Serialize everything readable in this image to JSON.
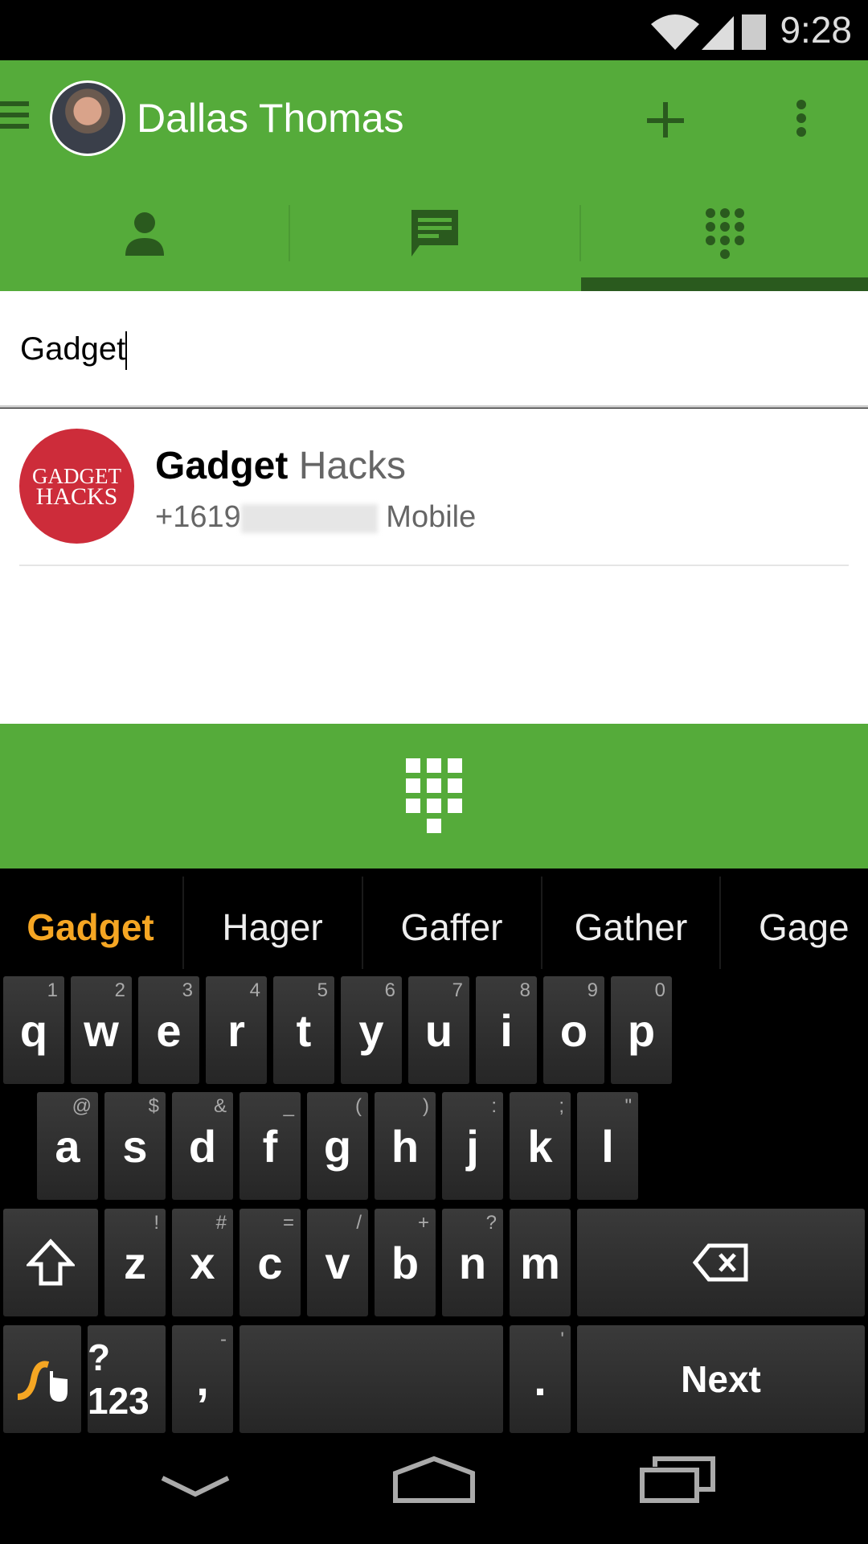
{
  "status": {
    "time": "9:28",
    "icons": [
      "wifi-icon",
      "signal-icon",
      "battery-icon"
    ]
  },
  "toolbar": {
    "title": "Dallas Thomas",
    "icons": [
      "menu-icon",
      "avatar",
      "add-icon",
      "more-icon"
    ],
    "color": "#55ab3a"
  },
  "tabs": [
    {
      "name": "contacts",
      "icon": "person-icon"
    },
    {
      "name": "messages",
      "icon": "message-icon"
    },
    {
      "name": "dialpad",
      "icon": "dialpad-icon",
      "selected": true
    }
  ],
  "search": {
    "value": "Gadget"
  },
  "results": [
    {
      "logo_line1": "GADGET",
      "logo_line2": "HACKS",
      "name_match": "Gadget",
      "name_rest": " Hacks",
      "phone_prefix": "+1619",
      "phone_type": "Mobile"
    }
  ],
  "keyboard": {
    "suggestions": [
      "Gadget",
      "Hager",
      "Gaffer",
      "Gather",
      "Gage"
    ],
    "row1": [
      [
        "q",
        "1"
      ],
      [
        "w",
        "2"
      ],
      [
        "e",
        "3"
      ],
      [
        "r",
        "4"
      ],
      [
        "t",
        "5"
      ],
      [
        "y",
        "6"
      ],
      [
        "u",
        "7"
      ],
      [
        "i",
        "8"
      ],
      [
        "o",
        "9"
      ],
      [
        "p",
        "0"
      ]
    ],
    "row2": [
      [
        "a",
        "@"
      ],
      [
        "s",
        "$"
      ],
      [
        "d",
        "&"
      ],
      [
        "f",
        "_"
      ],
      [
        "g",
        "("
      ],
      [
        "h",
        ")"
      ],
      [
        "j",
        ":"
      ],
      [
        "k",
        ";"
      ],
      [
        "l",
        "\""
      ]
    ],
    "row3": [
      [
        "z",
        "!"
      ],
      [
        "x",
        "#"
      ],
      [
        "c",
        "="
      ],
      [
        "v",
        "/"
      ],
      [
        "b",
        "+"
      ],
      [
        "n",
        "?"
      ],
      [
        "m",
        ""
      ]
    ],
    "symbols_label": "?123",
    "comma": ",",
    "comma_hint": "-",
    "period": ".",
    "period_hint": "'",
    "action_label": "Next"
  }
}
